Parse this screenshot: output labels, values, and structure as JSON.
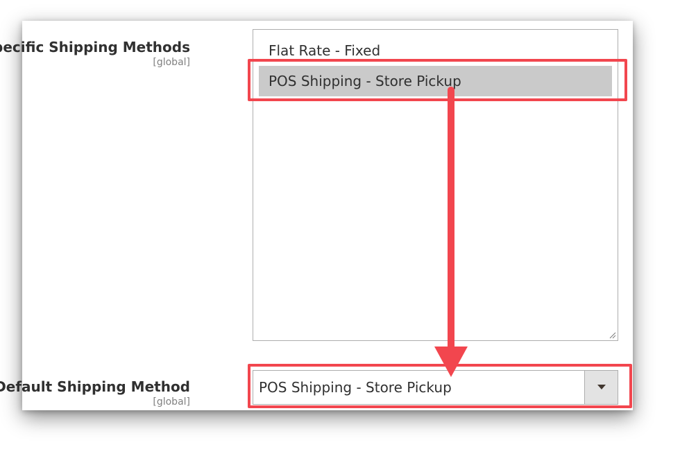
{
  "shipping_methods": {
    "label": "Specific Shipping Methods",
    "scope": "[global]",
    "options": [
      {
        "label": "Flat Rate - Fixed",
        "selected": false
      },
      {
        "label": "POS Shipping - Store Pickup",
        "selected": true
      }
    ]
  },
  "default_method": {
    "label": "Default Shipping Method",
    "scope": "[global]",
    "value": "POS Shipping - Store Pickup"
  },
  "colors": {
    "annotation": "#f2464e",
    "selected_option_bg": "#cacaca"
  }
}
